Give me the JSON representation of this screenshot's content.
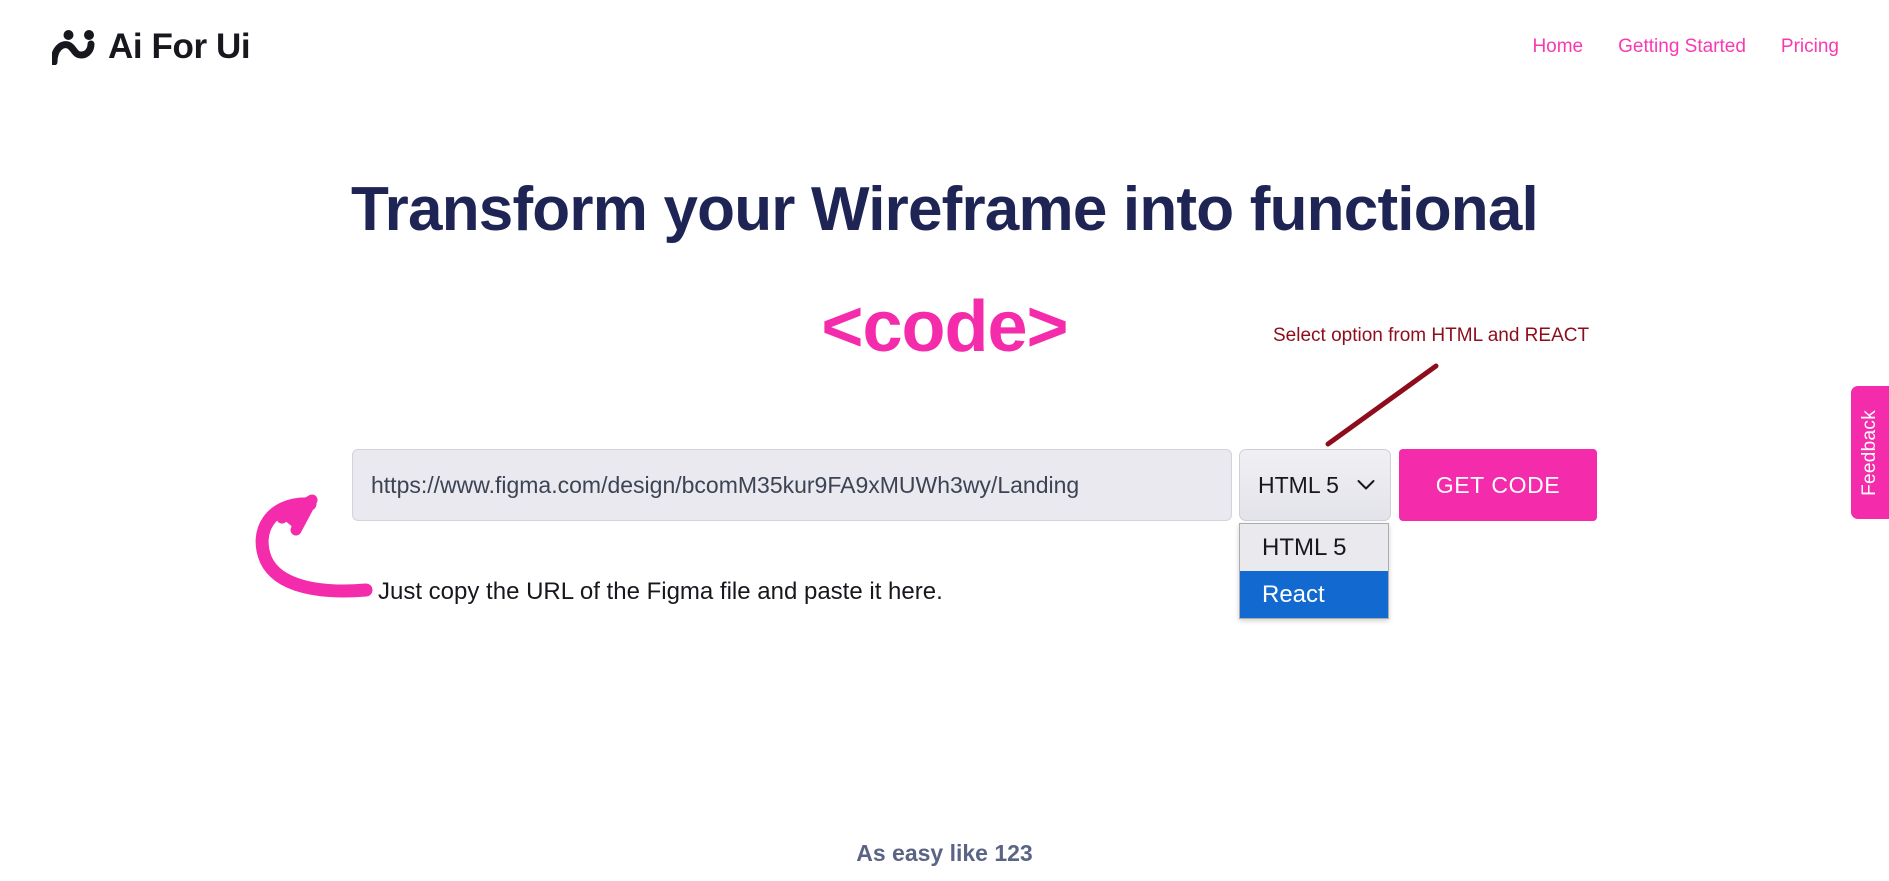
{
  "header": {
    "brand_name": "Ai For Ui",
    "logo_icon": "smiley-face-logo",
    "nav": [
      {
        "label": "Home"
      },
      {
        "label": "Getting Started"
      },
      {
        "label": "Pricing"
      }
    ]
  },
  "hero": {
    "heading": "Transform your Wireframe into functional",
    "code_word": "<code>"
  },
  "annotations": {
    "select_hint": "Select option from HTML and REACT",
    "select_hint_color": "#8e0d1c",
    "input_hint": "Just copy the URL of the Figma file and paste it here.",
    "arrow_color": "#f42bab"
  },
  "form": {
    "url_value": "https://www.figma.com/design/bcomM35kur9FA9xMUWh3wy/Landing",
    "url_placeholder": "https://www.figma.com/design/...",
    "format_selected": "HTML 5",
    "format_options": [
      {
        "label": "HTML 5",
        "highlighted": false
      },
      {
        "label": "React",
        "highlighted": true
      }
    ],
    "dropdown_open": true,
    "submit_label": "GET CODE",
    "chevron_icon": "chevron-down-icon"
  },
  "footer": {
    "tagline": "As easy like 123"
  },
  "feedback": {
    "label": "Feedback"
  },
  "colors": {
    "accent_pink": "#f42bab",
    "heading_navy": "#1e2454",
    "annotation_red": "#8e0d1c",
    "option_highlight_blue": "#1269cf",
    "tagline_slate": "#5b6485"
  }
}
